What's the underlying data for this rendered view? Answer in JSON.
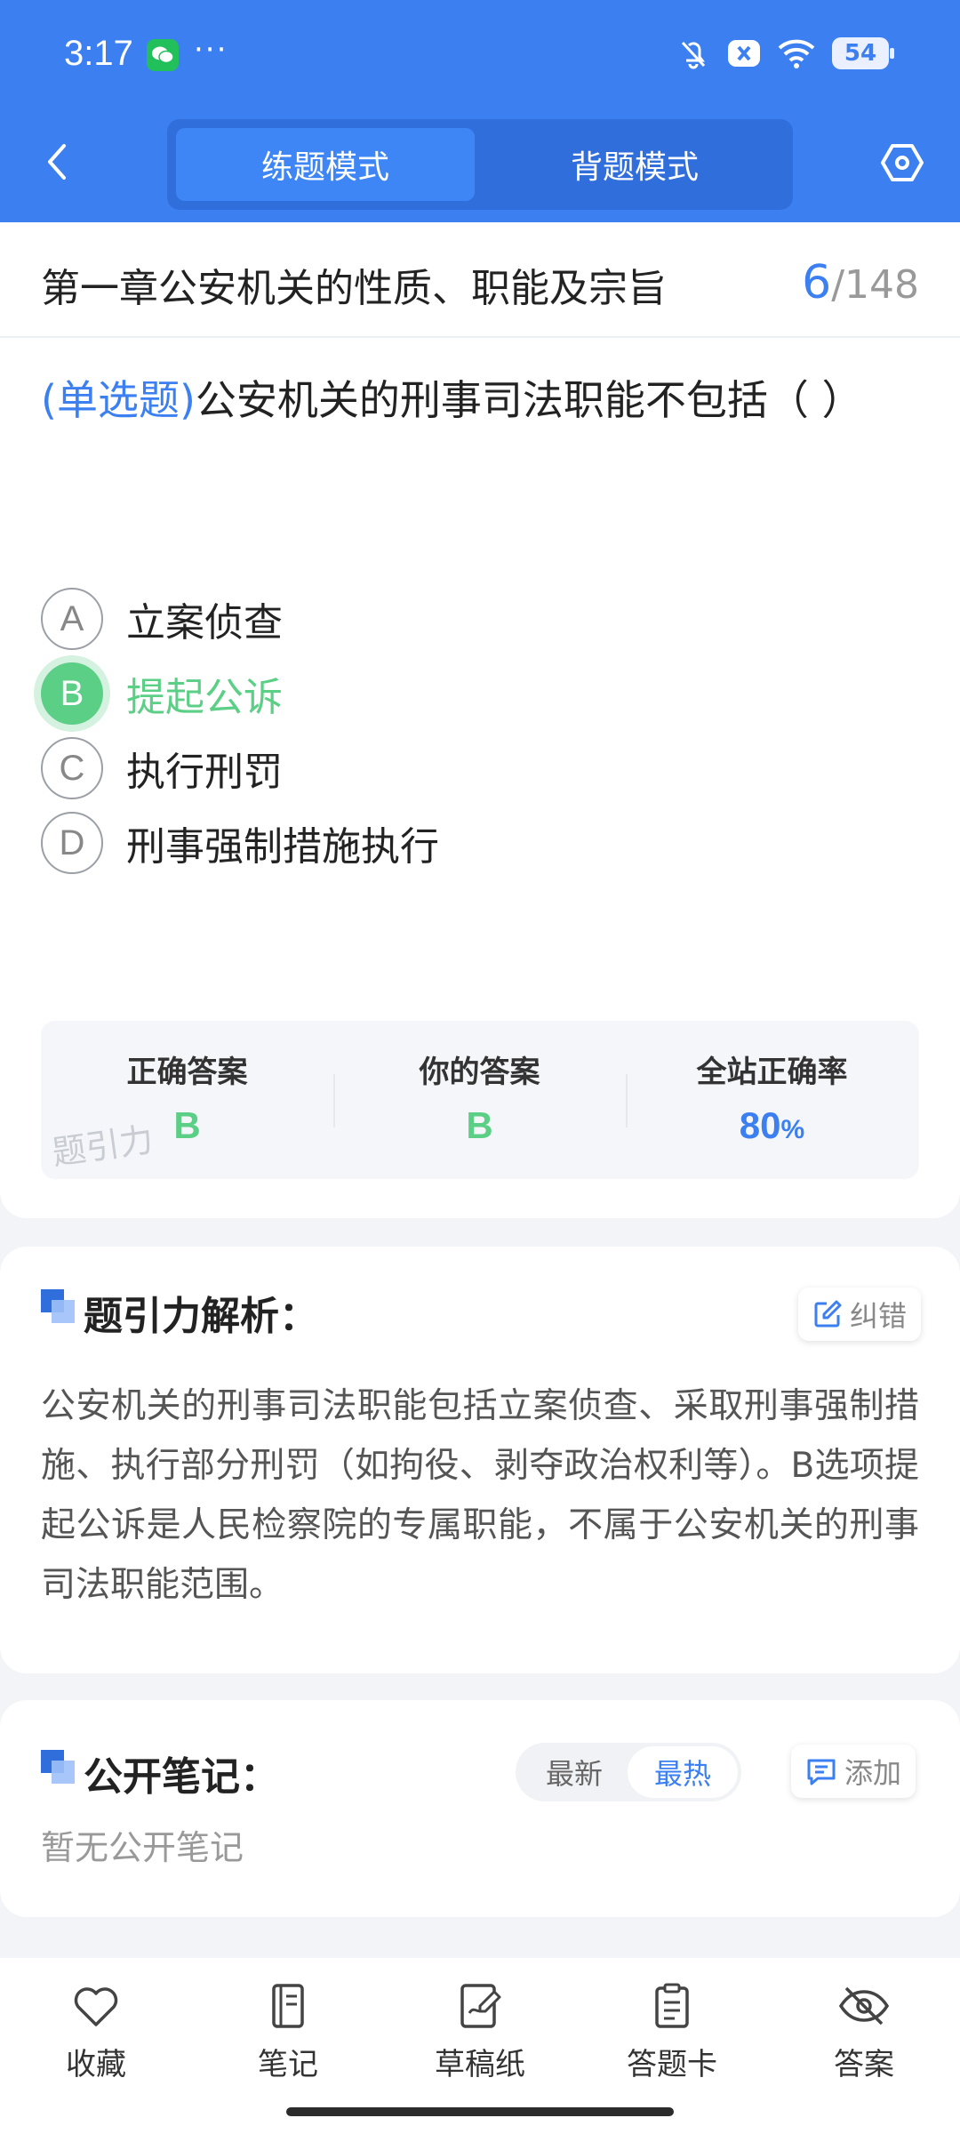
{
  "status": {
    "time": "3:17",
    "more": "···",
    "battery": "54"
  },
  "header": {
    "tabs": [
      {
        "label": "练题模式",
        "active": true
      },
      {
        "label": "背题模式",
        "active": false
      }
    ]
  },
  "chapter": {
    "title": "第一章公安机关的性质、职能及宗旨",
    "current": "6",
    "total": "/148"
  },
  "question": {
    "type": "(单选题)",
    "text": "公安机关的刑事司法职能不包括（    ）",
    "options": [
      {
        "letter": "A",
        "text": "立案侦查"
      },
      {
        "letter": "B",
        "text": "提起公诉",
        "state": "correct"
      },
      {
        "letter": "C",
        "text": "执行刑罚"
      },
      {
        "letter": "D",
        "text": "刑事强制措施执行"
      }
    ]
  },
  "stats": {
    "correct_label": "正确答案",
    "correct_value": "B",
    "yours_label": "你的答案",
    "yours_value": "B",
    "rate_label": "全站正确率",
    "rate_value": "80",
    "rate_unit": "%",
    "watermark": "题引力"
  },
  "analysis": {
    "title": "题引力解析：",
    "report_label": "纠错",
    "text": "公安机关的刑事司法职能包括立案侦查、采取刑事强制措施、执行部分刑罚（如拘役、剥夺政治权利等）。B选项提起公诉是人民检察院的专属职能，不属于公安机关的刑事司法职能范围。"
  },
  "notes": {
    "title": "公开笔记：",
    "sort_new": "最新",
    "sort_hot": "最热",
    "add_label": "添加",
    "empty": "暂无公开笔记"
  },
  "bottom_nav": [
    {
      "label": "收藏",
      "icon": "heart-icon"
    },
    {
      "label": "笔记",
      "icon": "notebook-icon"
    },
    {
      "label": "草稿纸",
      "icon": "draft-icon"
    },
    {
      "label": "答题卡",
      "icon": "answer-card-icon"
    },
    {
      "label": "答案",
      "icon": "eye-off-icon"
    }
  ],
  "colors": {
    "primary": "#3b7ff0",
    "correct": "#5ccf86"
  }
}
